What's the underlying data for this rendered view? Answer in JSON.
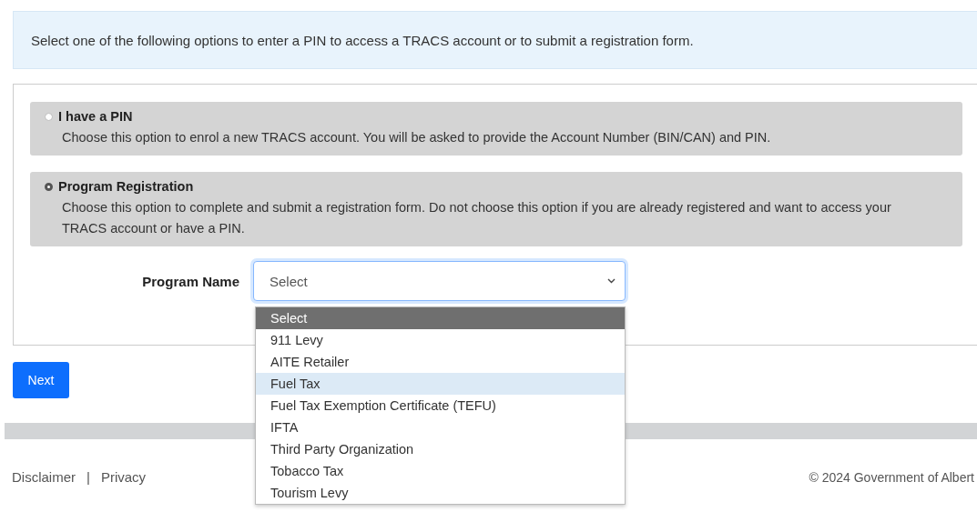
{
  "intro": "Select one of the following options to enter a PIN to access a TRACS account or to submit a registration form.",
  "options": [
    {
      "title": "I have a PIN",
      "description": "Choose this option to enrol a new TRACS account. You will be asked to provide the Account Number (BIN/CAN) and PIN.",
      "selected": false
    },
    {
      "title": "Program Registration",
      "description": "Choose this option to complete and submit a registration form. Do not choose this option if you are already registered and want to access your TRACS account or have a PIN.",
      "selected": true
    }
  ],
  "program_name": {
    "label": "Program Name",
    "value": "Select",
    "expanded": true,
    "choices": [
      {
        "label": "Select",
        "selected": true,
        "highlighted": false
      },
      {
        "label": "911 Levy",
        "selected": false,
        "highlighted": false
      },
      {
        "label": "AITE Retailer",
        "selected": false,
        "highlighted": false
      },
      {
        "label": "Fuel Tax",
        "selected": false,
        "highlighted": true
      },
      {
        "label": "Fuel Tax Exemption Certificate (TEFU)",
        "selected": false,
        "highlighted": false
      },
      {
        "label": "IFTA",
        "selected": false,
        "highlighted": false
      },
      {
        "label": "Third Party Organization",
        "selected": false,
        "highlighted": false
      },
      {
        "label": "Tobacco Tax",
        "selected": false,
        "highlighted": false
      },
      {
        "label": "Tourism Levy",
        "selected": false,
        "highlighted": false
      }
    ]
  },
  "next_button": "Next",
  "footer": {
    "links": [
      "Disclaimer",
      "Privacy"
    ],
    "separator": "|",
    "copyright": "© 2024 Government of Albert"
  }
}
